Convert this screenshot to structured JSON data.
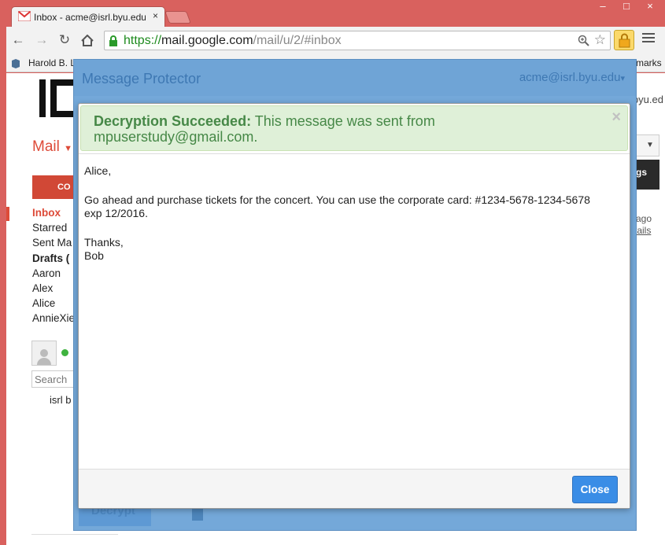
{
  "browser": {
    "tab": {
      "title": "Inbox - acme@isrl.byu.edu",
      "close": "×"
    },
    "window_controls": {
      "minimize": "–",
      "maximize": "□",
      "close": "×"
    },
    "url": {
      "scheme": "https://",
      "host": "mail.google.com",
      "path": "/mail/u/2/#inbox"
    },
    "bookmarks": {
      "first": "Harold B. L",
      "last": "marks"
    }
  },
  "gmail": {
    "account_partial": "byu.ed",
    "mail_label": "Mail",
    "compose_label": "CO",
    "nav_items": [
      {
        "label": "Inbox"
      },
      {
        "label": "Starred"
      },
      {
        "label": "Sent Ma"
      },
      {
        "label": "Drafts ("
      },
      {
        "label": "Aaron"
      },
      {
        "label": "Alex"
      },
      {
        "label": "Alice"
      },
      {
        "label": "AnnieXie"
      }
    ],
    "chat_search_placeholder": "Search",
    "chat_user": "isrl b",
    "right_button": "gs",
    "right_ago": "ago",
    "right_details": "tails"
  },
  "mp": {
    "title": "Message Protector",
    "account": "acme@isrl.byu.edu",
    "account_caret": "▾",
    "bg_decrypt": "Decrypt",
    "alert": {
      "strong": "Decryption Succeeded:",
      "text": " This message was sent from mpuserstudy@gmail.com.",
      "close": "×"
    },
    "message": {
      "greeting": "Alice,",
      "body_line1": "Go ahead and purchase tickets for the concert. You can use the corporate card:  #1234-5678-1234-5678",
      "body_line2": "exp 12/2016.",
      "signoff": "Thanks,",
      "signature": "Bob"
    },
    "close_button": "Close"
  },
  "colors": {
    "chrome_frame": "#d9615e",
    "gmail_red": "#dd4b39",
    "overlay_blue": "#74a8d9",
    "success_bg": "#dff0d8",
    "success_text": "#468847",
    "primary_button": "#3a8de6"
  }
}
